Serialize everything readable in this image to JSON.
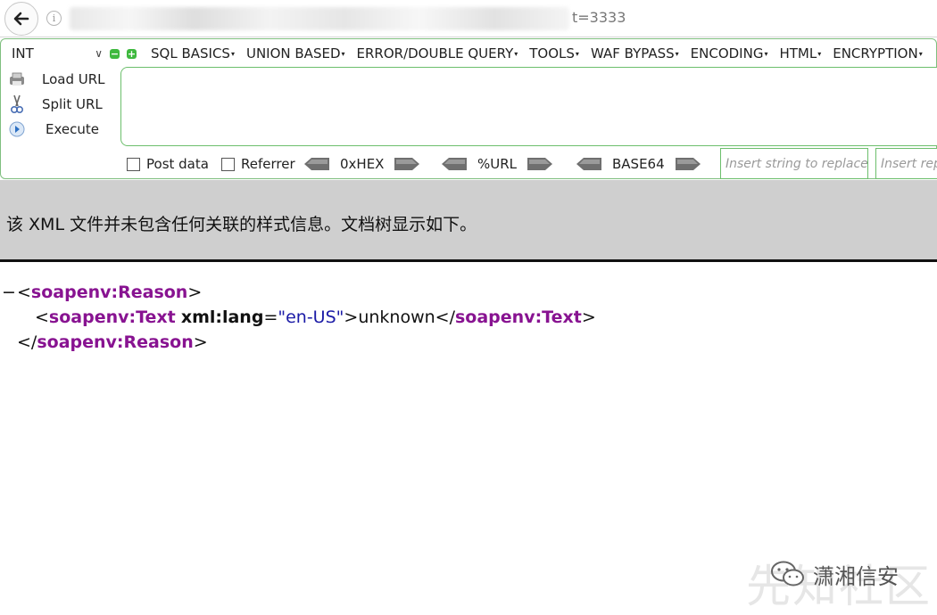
{
  "browser": {
    "url_tail": "t=3333"
  },
  "hackbar": {
    "int_select": "INT",
    "menu": [
      {
        "label": "SQL BASICS"
      },
      {
        "label": "UNION BASED"
      },
      {
        "label": "ERROR/DOUBLE QUERY"
      },
      {
        "label": "TOOLS"
      },
      {
        "label": "WAF BYPASS"
      },
      {
        "label": "ENCODING"
      },
      {
        "label": "HTML"
      },
      {
        "label": "ENCRYPTION"
      }
    ],
    "load_url": "Load URL",
    "split_url": "Split URL",
    "execute": "Execute",
    "post_data": "Post data",
    "referrer": "Referrer",
    "hex": "0xHEX",
    "url_enc": "%URL",
    "base64": "BASE64",
    "replace_placeholder": "Insert string to replace",
    "replace_with_placeholder": "Insert replacing string"
  },
  "xml_viewer": {
    "info": "该 XML 文件并未包含任何关联的样式信息。文档树显示如下。",
    "collapse_symbol": "−",
    "reason_tag": "soapenv:Reason",
    "text_tag": "soapenv:Text",
    "attr_name": "xml:lang",
    "attr_value": "\"en-US\"",
    "text_content": "unknown"
  },
  "watermark": {
    "label": "潇湘信安",
    "ghost": "先知社区"
  },
  "colors": {
    "tag": "#881391",
    "attr_value": "#1a1aa6",
    "hackbar_border": "#6cbf6c",
    "banner": "#cfcfcf"
  }
}
